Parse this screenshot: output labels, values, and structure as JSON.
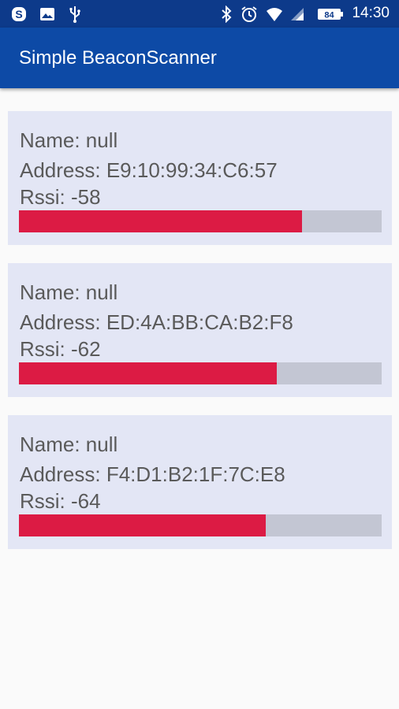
{
  "status_bar": {
    "time": "14:30",
    "battery": "84",
    "icons": [
      "skype-icon",
      "image-icon",
      "usb-icon",
      "bluetooth-icon",
      "alarm-icon",
      "wifi-icon",
      "signal-icon",
      "battery-icon"
    ]
  },
  "app": {
    "title": "Simple BeaconScanner"
  },
  "beacons": [
    {
      "name": "Name: null",
      "address": "Address: E9:10:99:34:C6:57",
      "rssi": "Rssi: -58",
      "signal_fraction": 0.78
    },
    {
      "name": "Name: null",
      "address": "Address: ED:4A:BB:CA:B2:F8",
      "rssi": "Rssi: -62",
      "signal_fraction": 0.71
    },
    {
      "name": "Name: null",
      "address": "Address: F4:D1:B2:1F:7C:E8",
      "rssi": "Rssi: -64",
      "signal_fraction": 0.68
    }
  ],
  "colors": {
    "status_bar": "#0d3a8a",
    "app_bar": "#0d4aa6",
    "card_bg": "#e3e6f5",
    "bar_fill": "#dc1b44",
    "bar_track": "#c3c6d3",
    "text": "#5a5a5a"
  }
}
